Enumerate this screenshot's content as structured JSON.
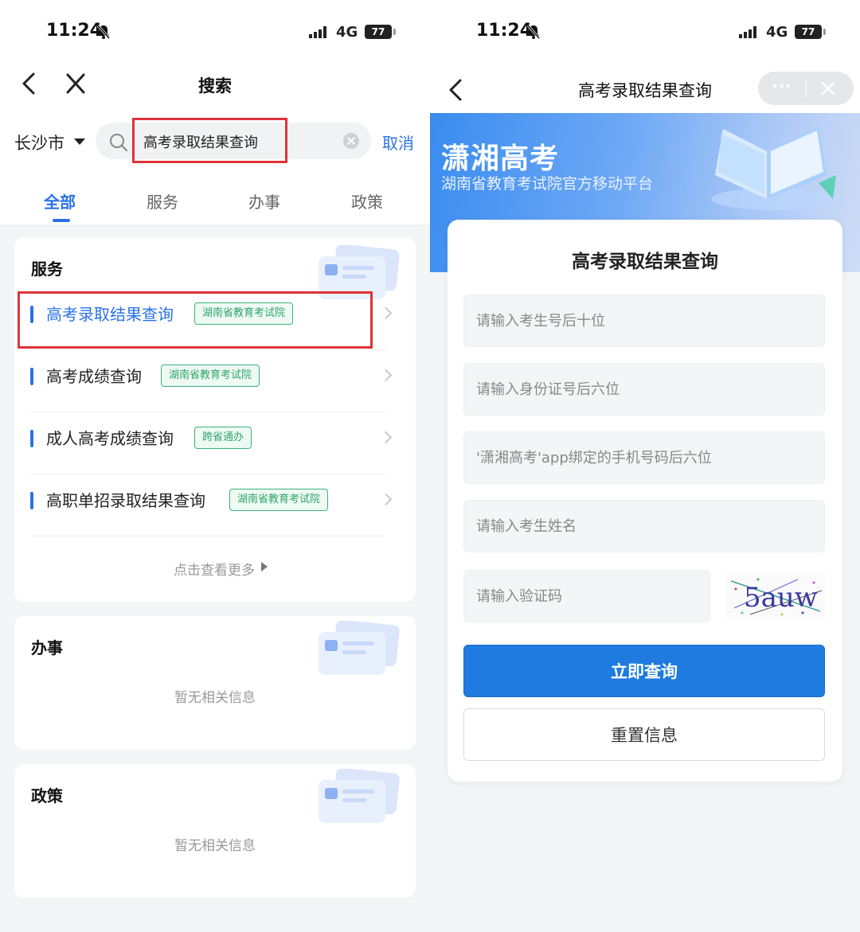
{
  "left": {
    "status": {
      "time": "11:24",
      "network": "4G",
      "battery": "77"
    },
    "nav": {
      "title": "搜索"
    },
    "search": {
      "city": "长沙市",
      "query": "高考录取结果查询",
      "cancel": "取消"
    },
    "tabs": [
      {
        "label": "全部",
        "active": true
      },
      {
        "label": "服务",
        "active": false
      },
      {
        "label": "办事",
        "active": false
      },
      {
        "label": "政策",
        "active": false
      }
    ],
    "services": {
      "title": "服务",
      "items": [
        {
          "title": "高考录取结果查询",
          "tag": "湖南省教育考试院"
        },
        {
          "title": "高考成绩查询",
          "tag": "湖南省教育考试院"
        },
        {
          "title": "成人高考成绩查询",
          "tag": "跨省通办"
        },
        {
          "title": "高职单招录取结果查询",
          "tag": "湖南省教育考试院"
        }
      ],
      "more": "点击查看更多"
    },
    "affairs": {
      "title": "办事",
      "empty": "暂无相关信息"
    },
    "policy": {
      "title": "政策",
      "empty": "暂无相关信息"
    },
    "colors": {
      "accent": "#2a72e8",
      "highlight": "#e0323a",
      "tag": "#2fa56c"
    }
  },
  "right": {
    "status": {
      "time": "11:24",
      "network": "4G",
      "battery": "77"
    },
    "nav": {
      "title": "高考录取结果查询"
    },
    "banner": {
      "title": "潇湘高考",
      "subtitle": "湖南省教育考试院官方移动平台"
    },
    "form": {
      "title": "高考录取结果查询",
      "exam_no_placeholder": "请输入考生号后十位",
      "id_placeholder": "请输入身份证号后六位",
      "phone_placeholder": "'潇湘高考'app绑定的手机号码后六位",
      "name_placeholder": "请输入考生姓名",
      "captcha_placeholder": "请输入验证码",
      "captcha_text": "5auw",
      "submit": "立即查询",
      "reset": "重置信息"
    },
    "colors": {
      "primary": "#1f7be0"
    }
  }
}
